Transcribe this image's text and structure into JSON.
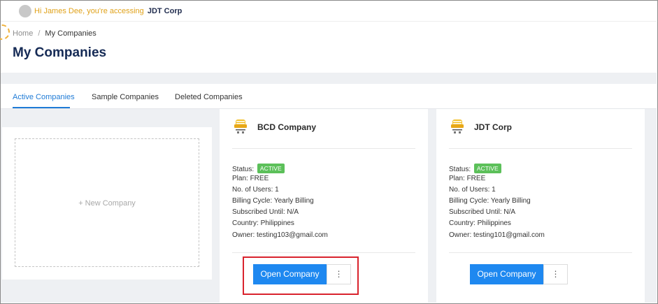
{
  "topbar": {
    "greeting": "Hi James Dee, you're accessing",
    "company": "JDT Corp"
  },
  "breadcrumb": {
    "home": "Home",
    "separator": "/",
    "current": "My Companies"
  },
  "page_title": "My Companies",
  "tabs": [
    {
      "label": "Active Companies",
      "active": true
    },
    {
      "label": "Sample Companies",
      "active": false
    },
    {
      "label": "Deleted Companies",
      "active": false
    }
  ],
  "new_company": {
    "label": "+ New Company"
  },
  "companies": [
    {
      "name": "BCD Company",
      "status_label": "Status:",
      "status": "ACTIVE",
      "plan": "Plan: FREE",
      "users": "No. of Users: 1",
      "billing": "Billing Cycle: Yearly Billing",
      "subscribed": "Subscribed Until: N/A",
      "country": "Country: Philippines",
      "owner": "Owner: testing103@gmail.com",
      "open_label": "Open Company",
      "more_label": "⋮"
    },
    {
      "name": "JDT Corp",
      "status_label": "Status:",
      "status": "ACTIVE",
      "plan": "Plan: FREE",
      "users": "No. of Users: 1",
      "billing": "Billing Cycle: Yearly Billing",
      "subscribed": "Subscribed Until: N/A",
      "country": "Country: Philippines",
      "owner": "Owner: testing101@gmail.com",
      "open_label": "Open Company",
      "more_label": "⋮"
    }
  ],
  "colors": {
    "accent": "#1e88f0",
    "status_active": "#5cc05a",
    "title": "#152a55",
    "greeting": "#e0a21a",
    "highlight": "#d9232d"
  }
}
